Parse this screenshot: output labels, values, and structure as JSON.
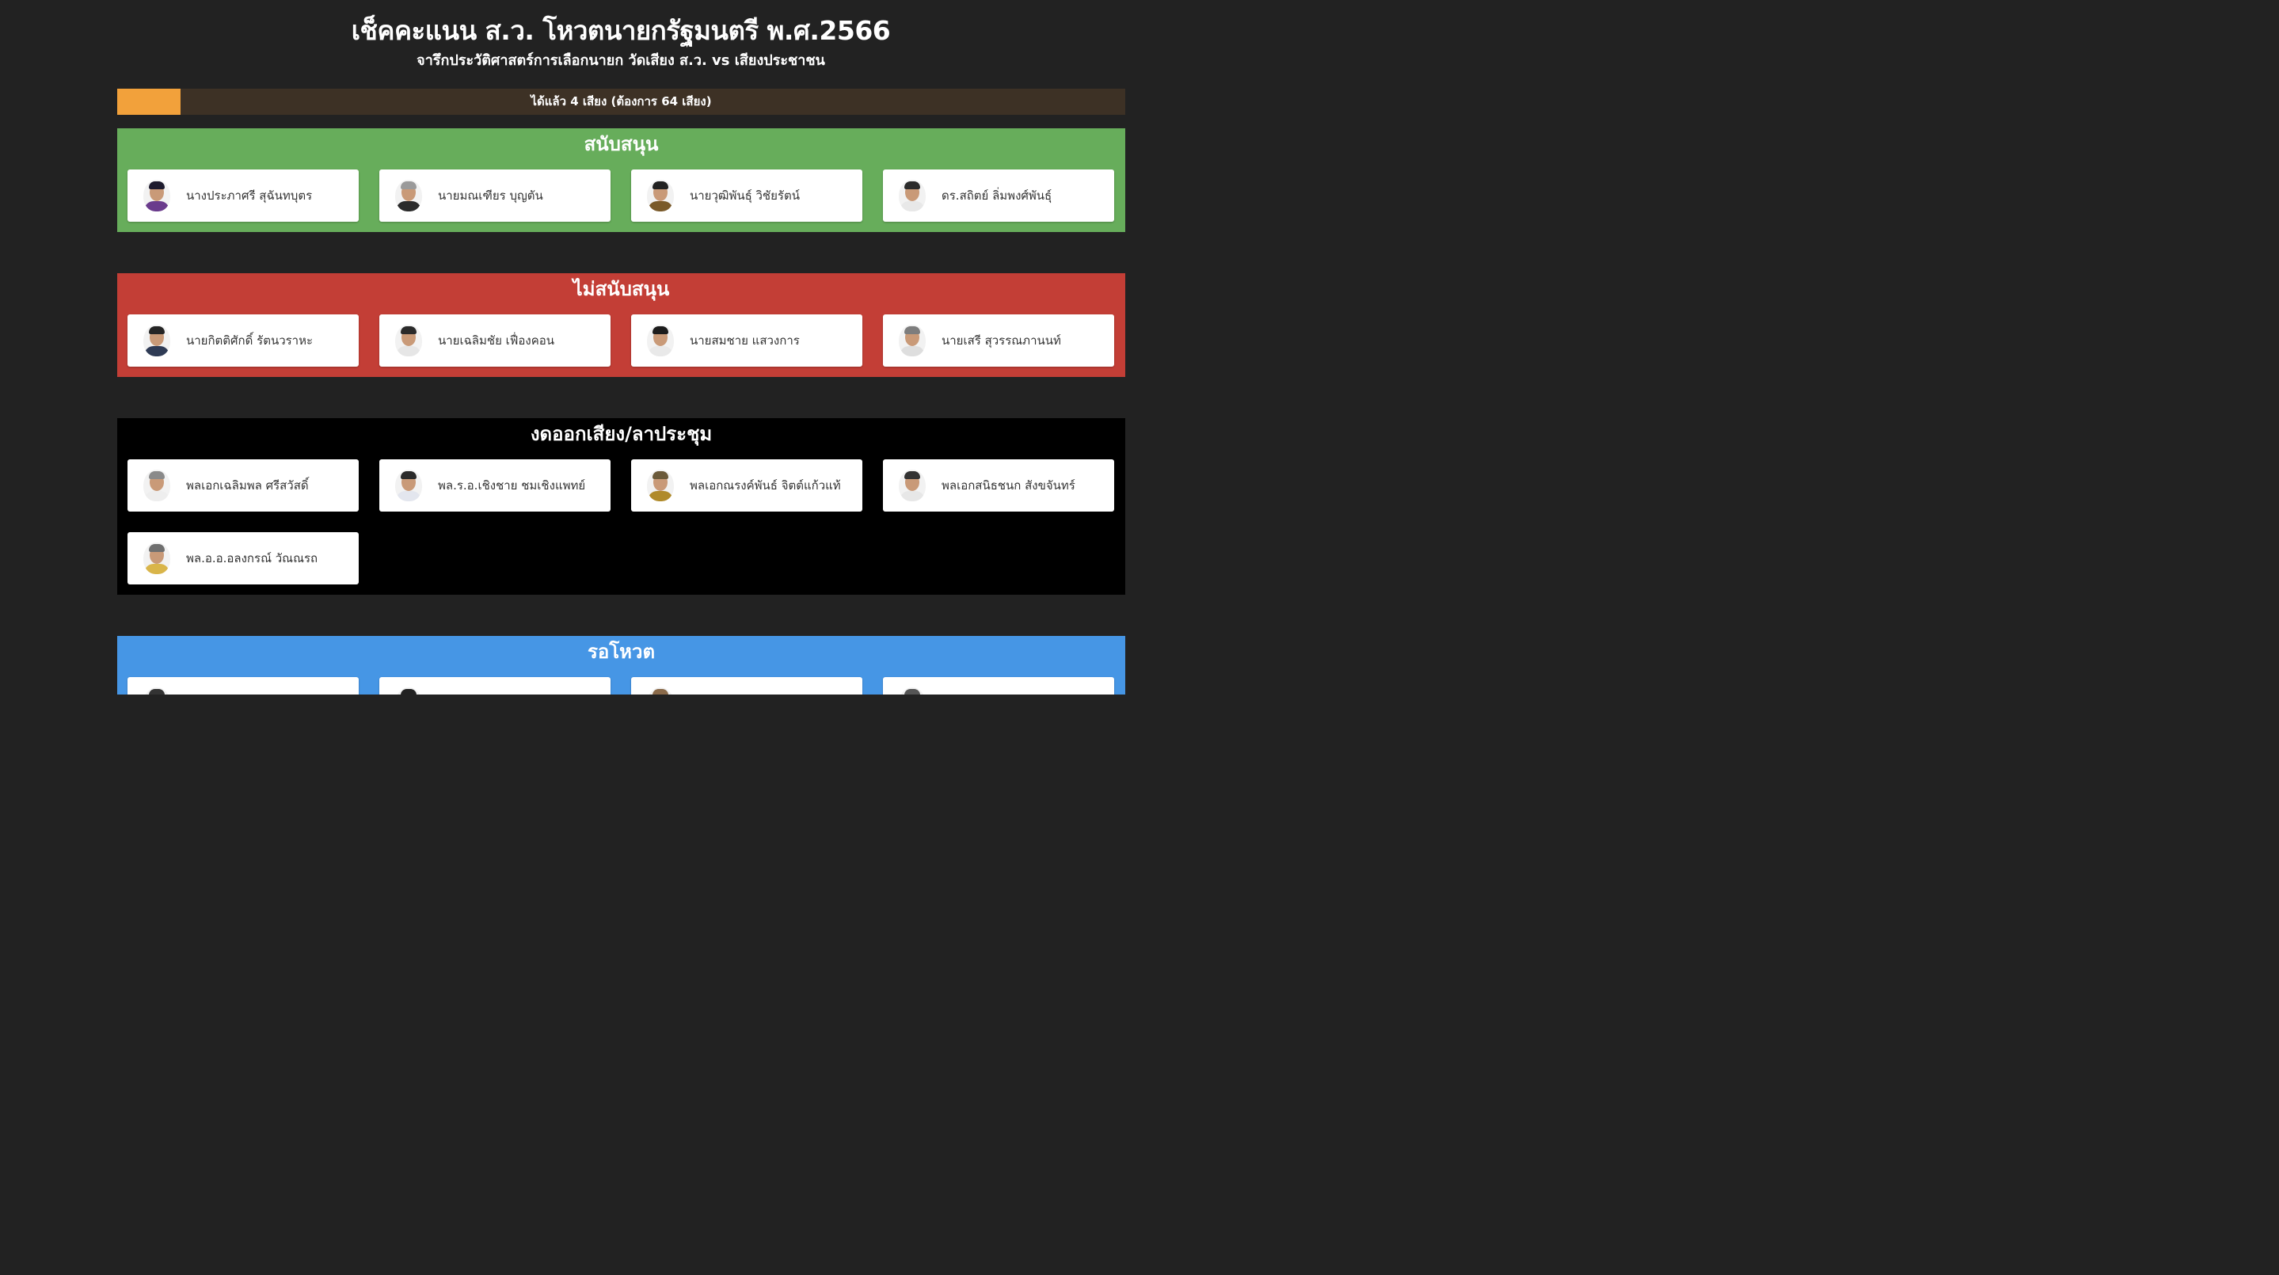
{
  "header": {
    "title": "เช็คคะแนน ส.ว. โหวตนายกรัฐมนตรี พ.ศ.2566",
    "subtitle": "จารึกประวัติศาสตร์การเลือกนายก วัดเสียง ส.ว. vs เสียงประชาชน"
  },
  "progress": {
    "label": "ได้แล้ว 4 เสียง (ต้องการ 64 เสียง)",
    "current": 4,
    "target": 64,
    "fill_color": "#f2a13b",
    "track_color": "#3d3125"
  },
  "sections": [
    {
      "title": "สนับสนุน",
      "color": "#67ad5b",
      "members": [
        {
          "name": "นางประภาศรี สุฉันทบุตร",
          "hair": "#1e1b2e",
          "suit": "#6a3b8c"
        },
        {
          "name": "นายมณเฑียร บุญตัน",
          "hair": "#9a9a9a",
          "suit": "#2b2b2b"
        },
        {
          "name": "นายวุฒิพันธุ์ วิชัยรัตน์",
          "hair": "#222222",
          "suit": "#7a5a2a"
        },
        {
          "name": "ดร.สถิตย์ ลิ่มพงศ์พันธุ์",
          "hair": "#2c2c2c",
          "suit": "#e8e8e8"
        }
      ]
    },
    {
      "title": "ไม่สนับสนุน",
      "color": "#c33e36",
      "members": [
        {
          "name": "นายกิตติศักดิ์ รัตนวราหะ",
          "hair": "#252525",
          "suit": "#2f3b55"
        },
        {
          "name": "นายเฉลิมชัย เฟื่องคอน",
          "hair": "#2a2a2a",
          "suit": "#e6e6e6"
        },
        {
          "name": "นายสมชาย แสวงการ",
          "hair": "#1c1c1c",
          "suit": "#e9e9e9"
        },
        {
          "name": "นายเสรี สุวรรณภานนท์",
          "hair": "#7d7d7d",
          "suit": "#dedede"
        }
      ]
    },
    {
      "title": "งดออกเสียง/ลาประชุม",
      "color": "#000000",
      "members": [
        {
          "name": "พลเอกเฉลิมพล ศรีสวัสดิ์",
          "hair": "#8a8a8a",
          "suit": "#eeeeee"
        },
        {
          "name": "พล.ร.อ.เชิงชาย ชมเชิงแพทย์",
          "hair": "#2a2a2a",
          "suit": "#e3e6ee"
        },
        {
          "name": "พลเอกณรงค์พันธ์ จิตต์แก้วแท้",
          "hair": "#6b5a3a",
          "suit": "#b08a2a"
        },
        {
          "name": "พลเอกสนิธชนก สังขจันทร์",
          "hair": "#333333",
          "suit": "#e7e7e7"
        },
        {
          "name": "พล.อ.อ.อลงกรณ์ วัณณรถ",
          "hair": "#6f6f6f",
          "suit": "#d9b54a"
        }
      ]
    },
    {
      "title": "รอโหวต",
      "color": "#4696e5",
      "members": [
        {
          "name": "",
          "hair": "#333333",
          "suit": "#444444"
        },
        {
          "name": "",
          "hair": "#222222",
          "suit": "#444444"
        },
        {
          "name": "",
          "hair": "#8a6a4a",
          "suit": "#444444"
        },
        {
          "name": "",
          "hair": "#555555",
          "suit": "#444444"
        }
      ]
    }
  ]
}
